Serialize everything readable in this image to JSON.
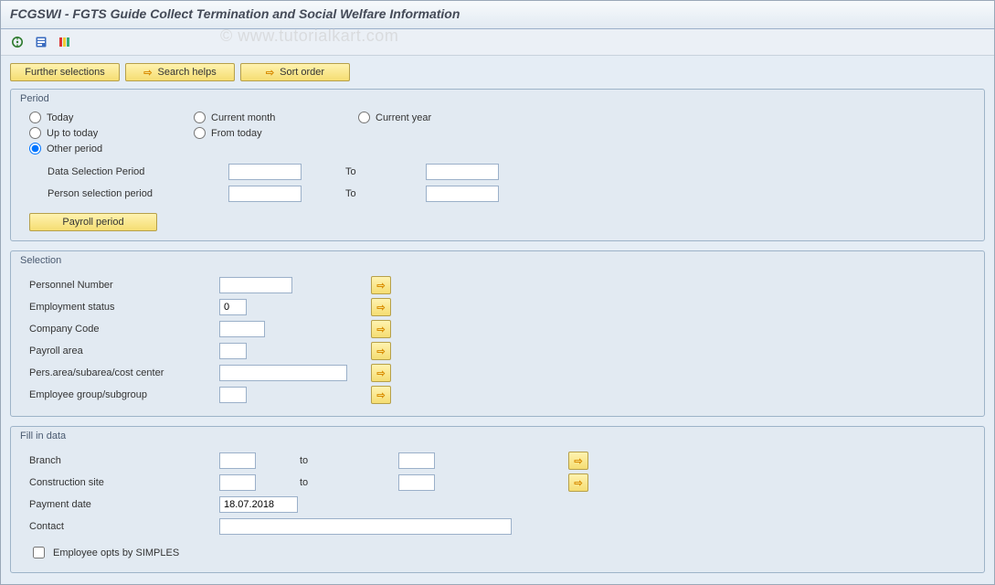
{
  "header": {
    "title": "FCGSWI - FGTS Guide Collect Termination and Social Welfare Information"
  },
  "watermark": "© www.tutorialkart.com",
  "buttons": {
    "further_selections": "Further selections",
    "search_helps": "Search helps",
    "sort_order": "Sort order",
    "payroll_period": "Payroll period"
  },
  "period": {
    "group_title": "Period",
    "today": "Today",
    "current_month": "Current month",
    "current_year": "Current year",
    "up_to_today": "Up to today",
    "from_today": "From today",
    "other_period": "Other period",
    "data_selection_period": "Data Selection Period",
    "person_selection_period": "Person selection period",
    "to_label": "To",
    "selected": "other_period",
    "values": {
      "data_from": "",
      "data_to": "",
      "person_from": "",
      "person_to": ""
    }
  },
  "selection": {
    "group_title": "Selection",
    "personnel_number": "Personnel Number",
    "employment_status": "Employment status",
    "company_code": "Company Code",
    "payroll_area": "Payroll area",
    "pers_area": "Pers.area/subarea/cost center",
    "employee_group": "Employee group/subgroup",
    "values": {
      "personnel_number": "",
      "employment_status": "0",
      "company_code": "",
      "payroll_area": "",
      "pers_area": "",
      "employee_group": ""
    }
  },
  "fill": {
    "group_title": "Fill in data",
    "branch": "Branch",
    "construction_site": "Construction site",
    "payment_date": "Payment date",
    "contact": "Contact",
    "simples": "Employee opts by SIMPLES",
    "to_label": "to",
    "values": {
      "branch_from": "",
      "branch_to": "",
      "construction_from": "",
      "construction_to": "",
      "payment_date": "18.07.2018",
      "contact": "",
      "simples_checked": false
    }
  }
}
